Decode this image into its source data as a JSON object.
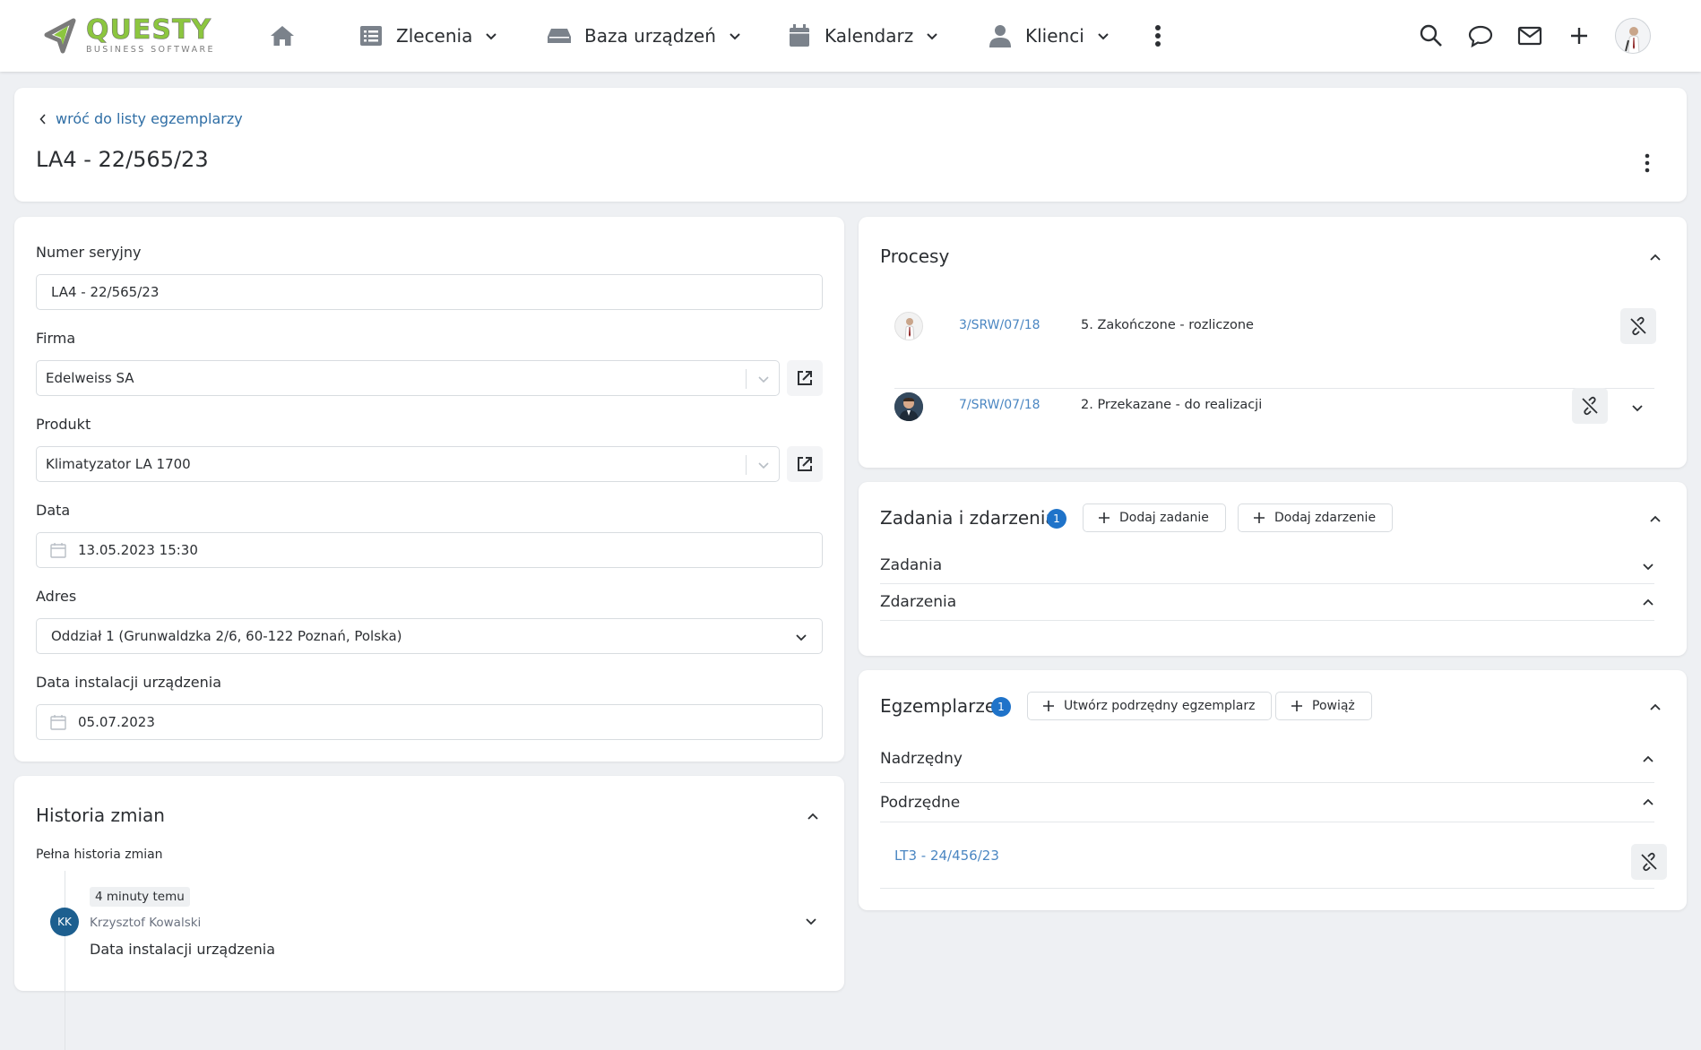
{
  "nav": {
    "logo_main": "QUESTY",
    "logo_sub": "BUSINESS SOFTWARE",
    "items": [
      {
        "label": "Zlecenia",
        "icon": "list-icon"
      },
      {
        "label": "Baza urządzeń",
        "icon": "device-icon"
      },
      {
        "label": "Kalendarz",
        "icon": "calendar-icon"
      },
      {
        "label": "Klienci",
        "icon": "user-icon"
      }
    ]
  },
  "header": {
    "back_label": "wróć do listy egzemplarzy",
    "title": "LA4 - 22/565/23"
  },
  "form": {
    "serial_label": "Numer seryjny",
    "serial_value": "LA4 - 22/565/23",
    "company_label": "Firma",
    "company_value": "Edelweiss SA",
    "product_label": "Produkt",
    "product_value": "Klimatyzator LA 1700",
    "date_label": "Data",
    "date_value": "13.05.2023 15:30",
    "address_label": "Adres",
    "address_value": "Oddział 1 (Grunwaldzka 2/6, 60-122 Poznań, Polska)",
    "install_label": "Data instalacji urządzenia",
    "install_value": "05.07.2023"
  },
  "history": {
    "title": "Historia zmian",
    "full_label": "Pełna historia zmian",
    "entries": [
      {
        "time": "4 minuty temu",
        "initials": "KK",
        "user": "Krzysztof Kowalski",
        "field": "Data instalacji urządzenia"
      }
    ]
  },
  "processes": {
    "title": "Procesy",
    "rows": [
      {
        "code": "3/SRW/07/18",
        "status": "5. Zakończone - rozliczone"
      },
      {
        "code": "7/SRW/07/18",
        "status": "2. Przekazane - do realizacji"
      }
    ]
  },
  "tasks": {
    "title": "Zadania i zdarzenia",
    "count": "1",
    "add_task": "Dodaj zadanie",
    "add_event": "Dodaj zdarzenie",
    "sub_tasks": "Zadania",
    "sub_events": "Zdarzenia"
  },
  "instances": {
    "title": "Egzemplarze",
    "count": "1",
    "create_child": "Utwórz podrzędny egzemplarz",
    "link": "Powiąż",
    "parent_label": "Nadrzędny",
    "children_label": "Podrzędne",
    "children": [
      {
        "code": "LT3 - 24/456/23"
      }
    ]
  },
  "colors": {
    "accent": "#1f73c9",
    "link": "#4a86c2",
    "logo_green": "#8cc63f"
  }
}
